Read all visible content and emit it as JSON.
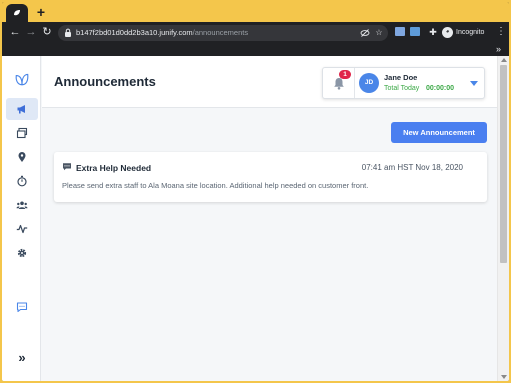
{
  "browser": {
    "new_tab_label": "+",
    "url_host": "b147f2bd01d0dd2b3a10.junify.com",
    "url_path": "/announcements",
    "incognito_label": "Incognito",
    "bookmarks_more": "»"
  },
  "sidebar": {
    "items": [
      {
        "name": "logo",
        "icon": "leaf-logo-icon"
      },
      {
        "name": "announcements",
        "icon": "megaphone-icon",
        "active": true
      },
      {
        "name": "windows",
        "icon": "stacked-windows-icon"
      },
      {
        "name": "locations",
        "icon": "map-pin-icon"
      },
      {
        "name": "timer",
        "icon": "stopwatch-icon"
      },
      {
        "name": "team",
        "icon": "users-icon"
      },
      {
        "name": "activity",
        "icon": "activity-icon"
      },
      {
        "name": "settings",
        "icon": "gear-icon"
      },
      {
        "name": "chat",
        "icon": "chat-icon"
      },
      {
        "name": "expand",
        "icon": "double-chevron-right-icon"
      }
    ],
    "expand_label": "»"
  },
  "header": {
    "title": "Announcements",
    "notification_count": "1",
    "user": {
      "initials": "JD",
      "name": "Jane Doe",
      "total_label": "Total Today",
      "timer": "00:00:00"
    }
  },
  "main": {
    "new_button_label": "New Announcement",
    "announcements": [
      {
        "title": "Extra Help Needed",
        "timestamp": "07:41 am HST Nov 18, 2020",
        "body": "Please send extra staff to Ala Moana site location. Additional help needed on customer front."
      }
    ]
  },
  "colors": {
    "frame": "#f4c64b",
    "accent": "#4a7ff0",
    "badge": "#e0254a",
    "timer_green": "#3aa845"
  }
}
